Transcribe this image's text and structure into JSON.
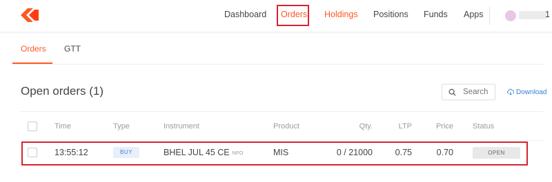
{
  "nav": {
    "items": [
      "Dashboard",
      "Orders",
      "Holdings",
      "Positions",
      "Funds",
      "Apps"
    ],
    "user_suffix": "1"
  },
  "tabs": [
    "Orders",
    "GTT"
  ],
  "section": {
    "title": "Open orders (1)",
    "search_placeholder": "Search",
    "download_label": "Download"
  },
  "table": {
    "headers": [
      "Time",
      "Type",
      "Instrument",
      "Product",
      "Qty.",
      "LTP",
      "Price",
      "Status"
    ],
    "rows": [
      {
        "time": "13:55:12",
        "type": "BUY",
        "instrument": "BHEL JUL 45 CE",
        "exchange": "NFO",
        "product": "MIS",
        "qty": "0 / 21000",
        "ltp": "0.75",
        "price": "0.70",
        "status": "OPEN"
      }
    ]
  },
  "colors": {
    "accent": "#ff5722",
    "link": "#387ed1",
    "highlight": "#d5222f"
  }
}
